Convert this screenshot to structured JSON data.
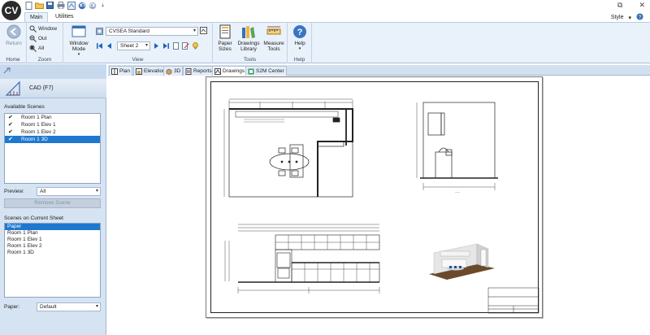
{
  "app": {
    "logo_text": "CV",
    "style_label": "Style",
    "style_arrow": "▾"
  },
  "ribbon_tabs": {
    "main": "Main",
    "utilities": "Utilities"
  },
  "ribbon": {
    "home": {
      "return_label": "Return",
      "group_label": "Home"
    },
    "zoom": {
      "window_label": "Window",
      "out_label": "Out",
      "all_label": "All",
      "group_label": "Zoom"
    },
    "view": {
      "window_mode_label": "Window\nMode",
      "window_mode_arrow": "▾",
      "standard_value": "CVSEA Standard",
      "sheet_value": "Sheet 2",
      "group_label": "View"
    },
    "tools": {
      "paper_sizes_label": "Paper\nSizes",
      "drawings_library_label": "Drawings\nLibrary",
      "measure_tools_label": "Measure\nTools",
      "measure_arrow": "▾",
      "group_label": "Tools"
    },
    "help": {
      "help_label": "Help",
      "help_arrow": "▾",
      "group_label": "Help"
    }
  },
  "left_panel": {
    "cad_label": "CAD (F7)",
    "available_scenes_label": "Available Scenes",
    "available_scenes": [
      {
        "label": "Room 1 Plan",
        "checked": true,
        "selected": false
      },
      {
        "label": "Room 1 Elev 1",
        "checked": true,
        "selected": false
      },
      {
        "label": "Room 1 Elev 2",
        "checked": true,
        "selected": false
      },
      {
        "label": "Room 1 3D",
        "checked": true,
        "selected": true
      }
    ],
    "preview_label": "Preview:",
    "preview_value": "All",
    "remove_scene_label": "Remove Scene",
    "scenes_on_sheet_label": "Scenes on Current Sheet",
    "scenes_on_sheet": [
      {
        "label": "Paper",
        "selected": true
      },
      {
        "label": "Room 1 Plan",
        "selected": false
      },
      {
        "label": "Room 1 Elev 1",
        "selected": false
      },
      {
        "label": "Room 1 Elev 2",
        "selected": false
      },
      {
        "label": "Room 1 3D",
        "selected": false
      }
    ],
    "paper_label": "Paper:",
    "paper_value": "Default"
  },
  "doc_tabs": [
    {
      "label": "Plan",
      "icon": "plan-icon",
      "active": false
    },
    {
      "label": "Elevation",
      "icon": "elevation-icon",
      "active": false
    },
    {
      "label": "3D",
      "icon": "cube-icon",
      "active": false
    },
    {
      "label": "Reports",
      "icon": "reports-icon",
      "active": false
    },
    {
      "label": "Drawings",
      "icon": "drawings-icon",
      "active": true
    },
    {
      "label": "S2M Center",
      "icon": "s2m-icon",
      "active": false
    }
  ],
  "colors": {
    "accent": "#1e78d0",
    "ribbon_bg": "#e9f1fa",
    "panel_bg": "#d6e3f2",
    "countertop_brown": "#6b4a2b"
  }
}
